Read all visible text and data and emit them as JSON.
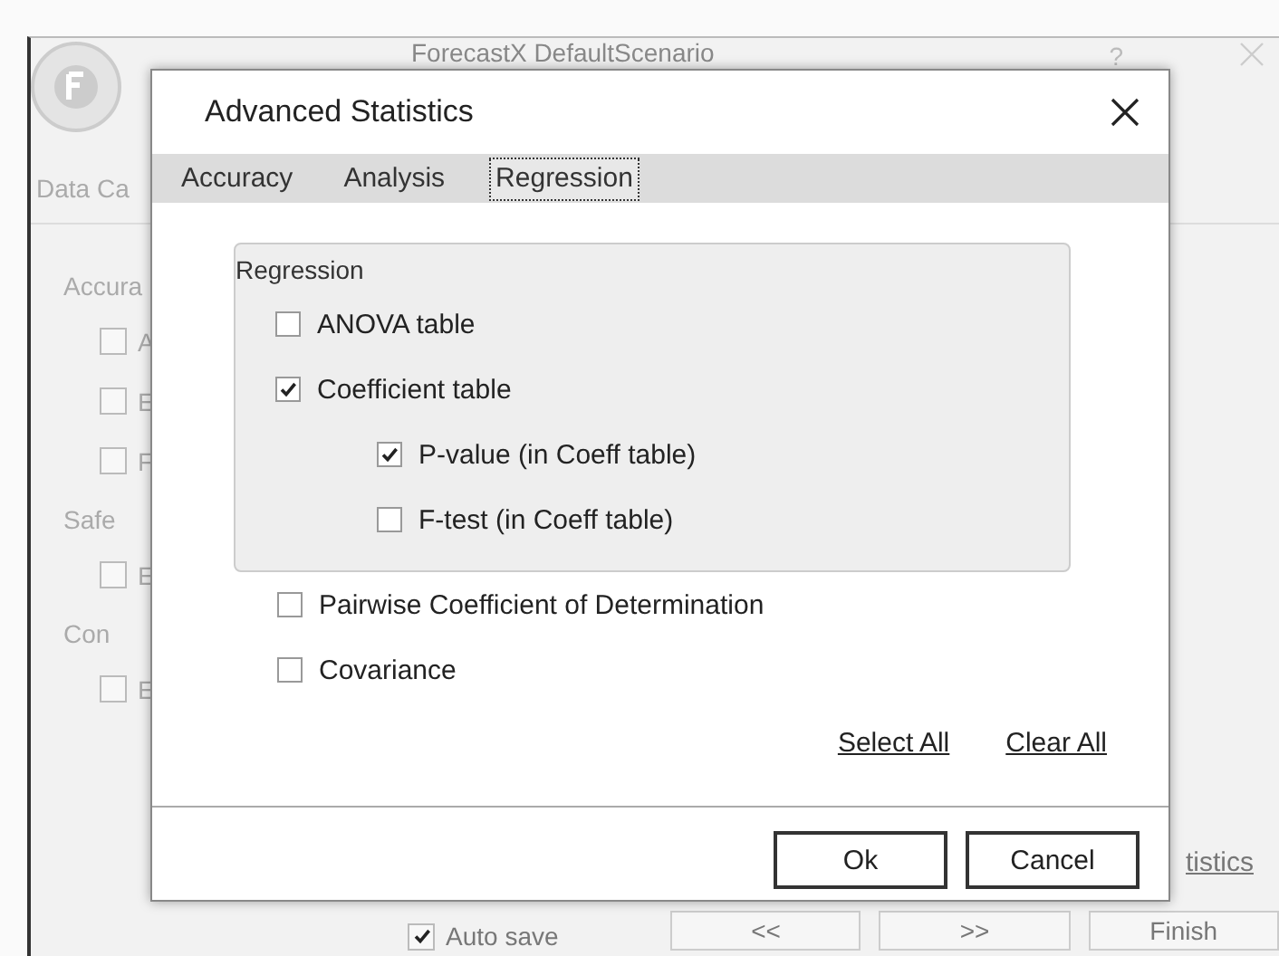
{
  "app": {
    "title": "ForecastX  DefaultScenario",
    "help": "?",
    "tab": "Data Ca",
    "sections": [
      {
        "heading": "Accura",
        "items": [
          {
            "label": "A",
            "checked": false
          },
          {
            "label": "E",
            "checked": false
          },
          {
            "label": "F",
            "checked": false
          }
        ]
      },
      {
        "heading": "Safe",
        "items": [
          {
            "label": "E",
            "checked": false
          }
        ]
      },
      {
        "heading": "Con",
        "items": [
          {
            "label": "E",
            "checked": false
          }
        ]
      }
    ],
    "link": "tistics",
    "auto_save": {
      "label": "Auto save",
      "checked": true
    },
    "nav_buttons": [
      "<<",
      ">>",
      "Finish"
    ]
  },
  "dialog": {
    "title": "Advanced Statistics",
    "tabs": [
      {
        "label": "Accuracy",
        "selected": false
      },
      {
        "label": "Analysis",
        "selected": false
      },
      {
        "label": "Regression",
        "selected": true
      }
    ],
    "group": {
      "title": "Regression",
      "options": [
        {
          "label": "ANOVA table",
          "checked": false
        },
        {
          "label": "Coefficient table",
          "checked": true,
          "children": [
            {
              "label": "P-value (in Coeff table)",
              "checked": true
            },
            {
              "label": "F-test (in Coeff table)",
              "checked": false
            }
          ]
        }
      ]
    },
    "options": [
      {
        "label": "Pairwise Coefficient of Determination",
        "checked": false
      },
      {
        "label": "Covariance",
        "checked": false
      }
    ],
    "links": [
      "Select All",
      "Clear All"
    ],
    "buttons": [
      "Ok",
      "Cancel"
    ]
  }
}
